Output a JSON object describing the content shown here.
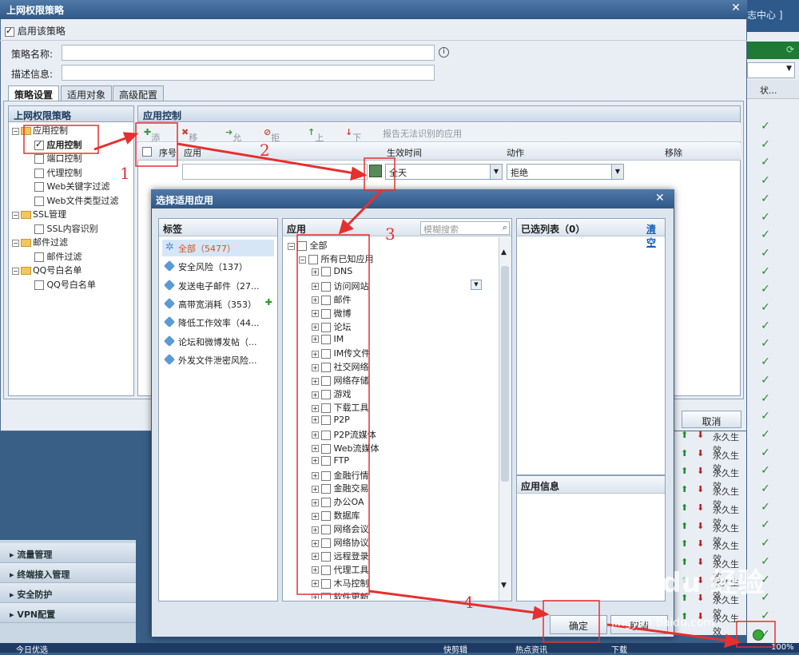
{
  "background_app": {
    "top_link": "志中心 ]",
    "header_col": "状...",
    "rows": [
      "永久生效",
      "永久生效",
      "永久生效",
      "永久生效",
      "永久生效",
      "永久生效",
      "永久生效",
      "永久生效",
      "永久生效",
      "永久生效",
      "永久生效"
    ],
    "left_nav": [
      "流量管理",
      "终端接入管理",
      "安全防护",
      "VPN配置"
    ],
    "taskbar_left": "今日优选",
    "taskbar_items": [
      "快剪辑",
      "热点资讯",
      "下载",
      "100%"
    ]
  },
  "policy_dialog": {
    "title": "上网权限策略",
    "enable_label": "启用该策略",
    "name_label": "策略名称:",
    "desc_label": "描述信息:",
    "tabs": [
      "策略设置",
      "适用对象",
      "高级配置"
    ],
    "left_panel_title": "上网权限策略",
    "tree": [
      {
        "label": "应用控制",
        "level": 0
      },
      {
        "label": "应用控制",
        "level": 1,
        "checked": true
      },
      {
        "label": "端口控制",
        "level": 1
      },
      {
        "label": "代理控制",
        "level": 1
      },
      {
        "label": "Web关键字过滤",
        "level": 1
      },
      {
        "label": "Web文件类型过滤",
        "level": 1
      },
      {
        "label": "SSL管理",
        "level": 0
      },
      {
        "label": "SSL内容识别",
        "level": 1
      },
      {
        "label": "邮件过滤",
        "level": 0
      },
      {
        "label": "邮件过滤",
        "level": 1
      },
      {
        "label": "QQ号白名单",
        "level": 0
      },
      {
        "label": "QQ号白名单",
        "level": 1
      }
    ],
    "right_panel_title": "应用控制",
    "toolbar": [
      "添加",
      "移除",
      "允许",
      "拒绝",
      "上移",
      "下移",
      "报告无法识别的应用"
    ],
    "grid_headers": [
      "序号",
      "应用",
      "生效时间",
      "动作",
      "移除"
    ],
    "row_time": "全天",
    "row_action": "拒绝",
    "cancel_label": "取消"
  },
  "select_dialog": {
    "title": "选择适用应用",
    "tags_header": "标签",
    "tags": [
      {
        "label": "全部（5477）",
        "selected": true
      },
      {
        "label": "安全风险（137）"
      },
      {
        "label": "发送电子邮件（27..."
      },
      {
        "label": "高带宽消耗（353）"
      },
      {
        "label": "降低工作效率（44..."
      },
      {
        "label": "论坛和微博发帖（..."
      },
      {
        "label": "外发文件泄密风险..."
      }
    ],
    "apps_header": "应用",
    "search_placeholder": "模糊搜索",
    "root": "全部",
    "known": "所有已知应用",
    "apps": [
      "DNS",
      "访问网站",
      "邮件",
      "微博",
      "论坛",
      "IM",
      "IM传文件",
      "社交网络",
      "网络存储",
      "游戏",
      "下载工具",
      "P2P",
      "P2P流媒体",
      "Web流媒体",
      "FTP",
      "金融行情",
      "金融交易",
      "办公OA",
      "数据库",
      "网络会议",
      "网络协议",
      "远程登录",
      "代理工具",
      "木马控制",
      "软件更新"
    ],
    "selected_header": "已选列表（0）",
    "clear_label": "清空",
    "app_info_header": "应用信息",
    "ok_label": "确定",
    "cancel_label": "取消"
  },
  "annotations": {
    "numbers": [
      "1",
      "2",
      "3",
      "4"
    ],
    "watermark": "Baidu 经验",
    "watermark_url": "jingyan.baidu.com"
  },
  "colors": {
    "title_bar": "#2f5886",
    "annotation_red": "#e53030",
    "check_green": "#2c8a2c"
  }
}
